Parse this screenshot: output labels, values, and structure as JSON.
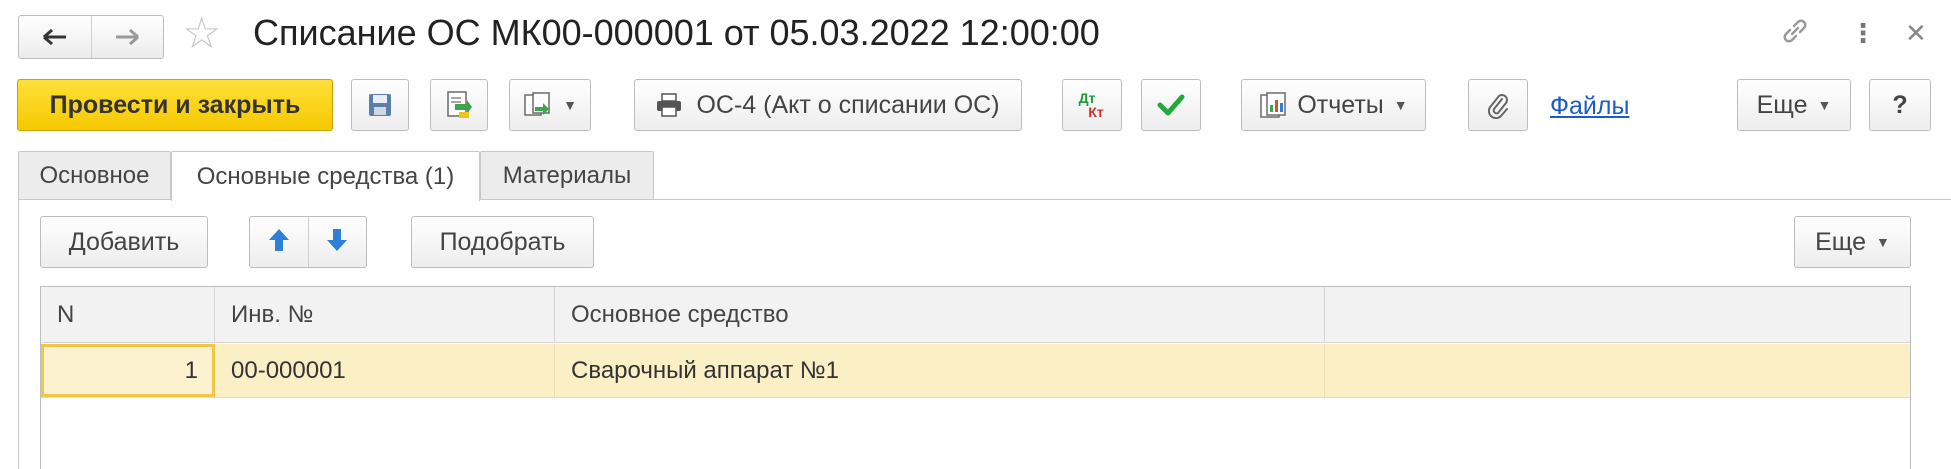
{
  "window": {
    "title": "Списание ОС МК00-000001 от 05.03.2022 12:00:00",
    "nav_back_icon": "arrow-left-icon",
    "nav_forward_icon": "arrow-right-icon",
    "favorite_icon": "star-icon",
    "link_icon": "link-icon",
    "menu_icon": "more-vertical-icon",
    "close_icon": "close-icon"
  },
  "toolbar": {
    "post_and_close_label": "Провести и закрыть",
    "save_icon": "save-icon",
    "post_icon": "post-document-icon",
    "create_based_icon": "create-based-on-icon",
    "print_label": "ОС-4 (Акт о списании ОС)",
    "dt_kt_label_top": "Дт",
    "dt_kt_label_bottom": "Кт",
    "check_icon": "check-icon",
    "reports_label": "Отчеты",
    "attach_icon": "paperclip-icon",
    "files_label": "Файлы",
    "more_label": "Еще",
    "help_label": "?"
  },
  "tabs": [
    {
      "label": "Основное",
      "active": false
    },
    {
      "label": "Основные средства (1)",
      "active": true
    },
    {
      "label": "Материалы",
      "active": false
    }
  ],
  "tab_toolbar": {
    "add_label": "Добавить",
    "up_icon": "arrow-up-icon",
    "down_icon": "arrow-down-icon",
    "pick_label": "Подобрать",
    "more_label": "Еще"
  },
  "grid": {
    "columns": [
      "N",
      "Инв. №",
      "Основное средство",
      ""
    ],
    "rows": [
      {
        "n": "1",
        "inv": "00-000001",
        "asset": "Сварочный аппарат №1",
        "extra": ""
      }
    ]
  },
  "colors": {
    "primary_button": "#f5c800",
    "link": "#1a5cc9",
    "selected_row": "#fbefc6",
    "arrow_blue": "#2f7fd8",
    "check_green": "#23a83a",
    "dt_green": "#1f9a3a",
    "kt_red": "#d62b2b"
  }
}
